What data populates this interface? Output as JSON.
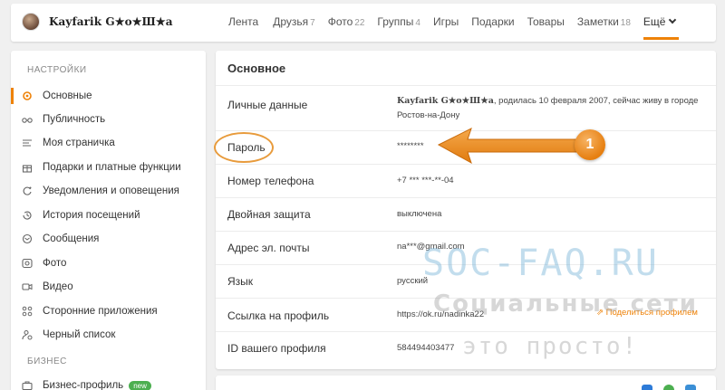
{
  "user": {
    "name": "Kayfarik G★o★Ш★а"
  },
  "nav": [
    {
      "label": "Лента",
      "count": ""
    },
    {
      "label": "Друзья",
      "count": "7"
    },
    {
      "label": "Фото",
      "count": "22"
    },
    {
      "label": "Группы",
      "count": "4"
    },
    {
      "label": "Игры",
      "count": ""
    },
    {
      "label": "Подарки",
      "count": ""
    },
    {
      "label": "Товары",
      "count": ""
    },
    {
      "label": "Заметки",
      "count": "18"
    }
  ],
  "nav_more": "Ещё",
  "sidebar": {
    "section1": "НАСТРОЙКИ",
    "items": [
      {
        "label": "Основные",
        "icon": "gear-icon"
      },
      {
        "label": "Публичность",
        "icon": "glasses-icon"
      },
      {
        "label": "Моя страничка",
        "icon": "lines-icon"
      },
      {
        "label": "Подарки и платные функции",
        "icon": "gift-icon"
      },
      {
        "label": "Уведомления и оповещения",
        "icon": "bell-icon"
      },
      {
        "label": "История посещений",
        "icon": "history-icon"
      },
      {
        "label": "Сообщения",
        "icon": "message-icon"
      },
      {
        "label": "Фото",
        "icon": "camera-icon"
      },
      {
        "label": "Видео",
        "icon": "video-icon"
      },
      {
        "label": "Сторонние приложения",
        "icon": "apps-icon"
      },
      {
        "label": "Черный список",
        "icon": "block-user-icon"
      }
    ],
    "section2": "БИЗНЕС",
    "business_item": "Бизнес-профиль",
    "business_badge": "new"
  },
  "main": {
    "title": "Основное",
    "rows": [
      {
        "label": "Личные данные",
        "name": "Kayfarik G★o★Ш★а",
        "rest": ", родилась 10 февраля 2007, сейчас живу в городе",
        "line2": "Ростов-на-Дону"
      },
      {
        "label": "Пароль",
        "value": "********"
      },
      {
        "label": "Номер телефона",
        "value": "+7 *** ***-**-04"
      },
      {
        "label": "Двойная защита",
        "value": "выключена"
      },
      {
        "label": "Адрес эл. почты",
        "value": "na***@gmail.com"
      },
      {
        "label": "Язык",
        "value": "русский"
      },
      {
        "label": "Ссылка на профиль",
        "value": "https://ok.ru/nadinka22",
        "share": "Поделиться профилем"
      },
      {
        "label": "ID вашего профиля",
        "value": "584494403477"
      }
    ]
  },
  "annotation": {
    "number": "1",
    "color": "#ee8208"
  },
  "watermark": {
    "line1": "SOC-FAQ.RU",
    "line2": "Социальные сети",
    "line3": "это просто!"
  }
}
